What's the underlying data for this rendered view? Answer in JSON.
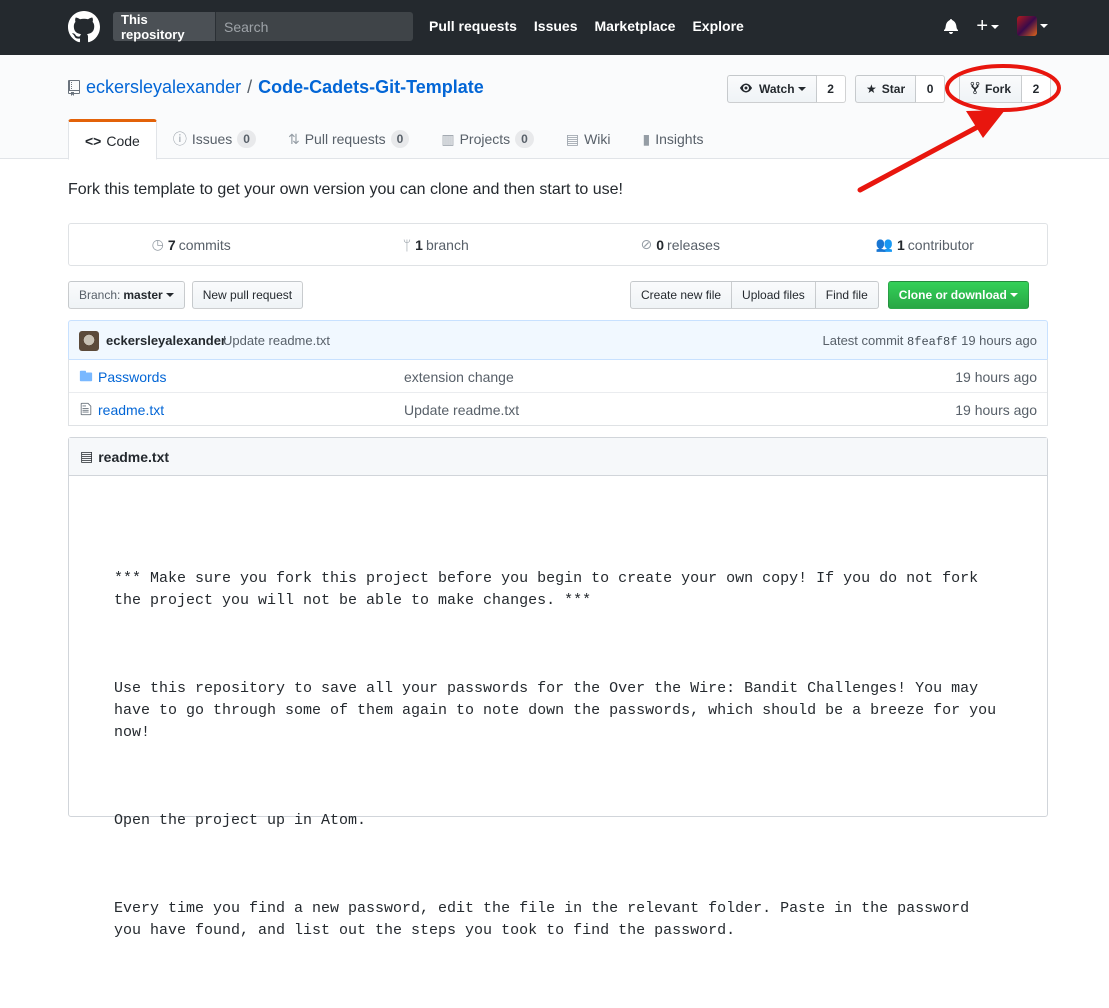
{
  "nav": {
    "search_scope": "This repository",
    "search_placeholder": "Search",
    "links": [
      "Pull requests",
      "Issues",
      "Marketplace",
      "Explore"
    ]
  },
  "repo": {
    "owner": "eckersleyalexander",
    "separator": "/",
    "name": "Code-Cadets-Git-Template",
    "watch_label": "Watch",
    "watch_count": "2",
    "star_label": "Star",
    "star_count": "0",
    "fork_label": "Fork",
    "fork_count": "2"
  },
  "tabs": [
    {
      "label": "Code",
      "icon": "code-icon"
    },
    {
      "label": "Issues",
      "icon": "issue-icon",
      "count": "0"
    },
    {
      "label": "Pull requests",
      "icon": "pull-request-icon",
      "count": "0"
    },
    {
      "label": "Projects",
      "icon": "project-icon",
      "count": "0"
    },
    {
      "label": "Wiki",
      "icon": "book-icon"
    },
    {
      "label": "Insights",
      "icon": "graph-icon"
    }
  ],
  "description": "Fork this template to get your own version you can clone and then start to use!",
  "summary": {
    "commits_count": "7",
    "commits_label": "commits",
    "branches_count": "1",
    "branches_label": "branch",
    "releases_count": "0",
    "releases_label": "releases",
    "contributors_count": "1",
    "contributors_label": "contributor"
  },
  "file_nav": {
    "branch_prefix": "Branch:",
    "branch": "master",
    "new_pr": "New pull request",
    "create_file": "Create new file",
    "upload_files": "Upload files",
    "find_file": "Find file",
    "clone": "Clone or download"
  },
  "commit": {
    "author": "eckersleyalexander",
    "message": "Update readme.txt",
    "latest_label": "Latest commit",
    "sha": "8feaf8f",
    "age": "19 hours ago"
  },
  "files": [
    {
      "name": "Passwords",
      "type": "folder",
      "message": "extension change",
      "age": "19 hours ago"
    },
    {
      "name": "readme.txt",
      "type": "file",
      "message": "Update readme.txt",
      "age": "19 hours ago"
    }
  ],
  "readme": {
    "title": "readme.txt",
    "paragraphs": [
      "*** Make sure you fork this project before you begin to create your own copy! If you do not fork the project you will not be able to make changes. ***",
      "Use this repository to save all your passwords for the Over the Wire: Bandit Challenges! You may have to go through some of them again to note down the passwords, which should be a breeze for you now!",
      "Open the project up in Atom.",
      "Every time you find a new password, edit the file in the relevant folder. Paste in the password you have found, and list out the steps you took to find the password."
    ]
  },
  "colors": {
    "annotation": "#e8160e",
    "header_bg": "#24292e",
    "link": "#0366d6",
    "clone_button": "#28a745",
    "tab_accent": "#e36209"
  }
}
